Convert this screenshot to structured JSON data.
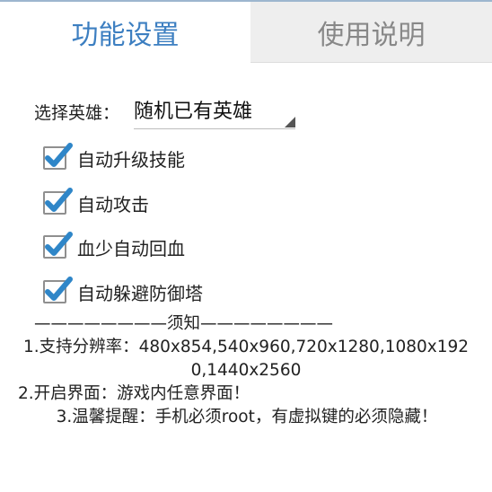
{
  "tabs": {
    "active_label": "功能设置",
    "inactive_label": "使用说明"
  },
  "hero_select": {
    "label": "选择英雄：",
    "value": "随机已有英雄"
  },
  "options": [
    {
      "label": "自动升级技能",
      "checked": true
    },
    {
      "label": "自动攻击",
      "checked": true
    },
    {
      "label": "血少自动回血",
      "checked": true
    },
    {
      "label": "自动躲避防御塔",
      "checked": true
    }
  ],
  "notice": {
    "divider": "————————须知————————",
    "line1": "1.支持分辨率：480x854,540x960,720x1280,1080x1920,1440x2560",
    "line2": "2.开启界面：游戏内任意界面！",
    "line3": "3.温馨提醒：手机必须root，有虚拟键的必须隐藏！"
  },
  "colors": {
    "active_tab_text": "#3d7fc1",
    "inactive_tab_bg": "#eeeeee",
    "check_mark": "#2f86c8"
  }
}
